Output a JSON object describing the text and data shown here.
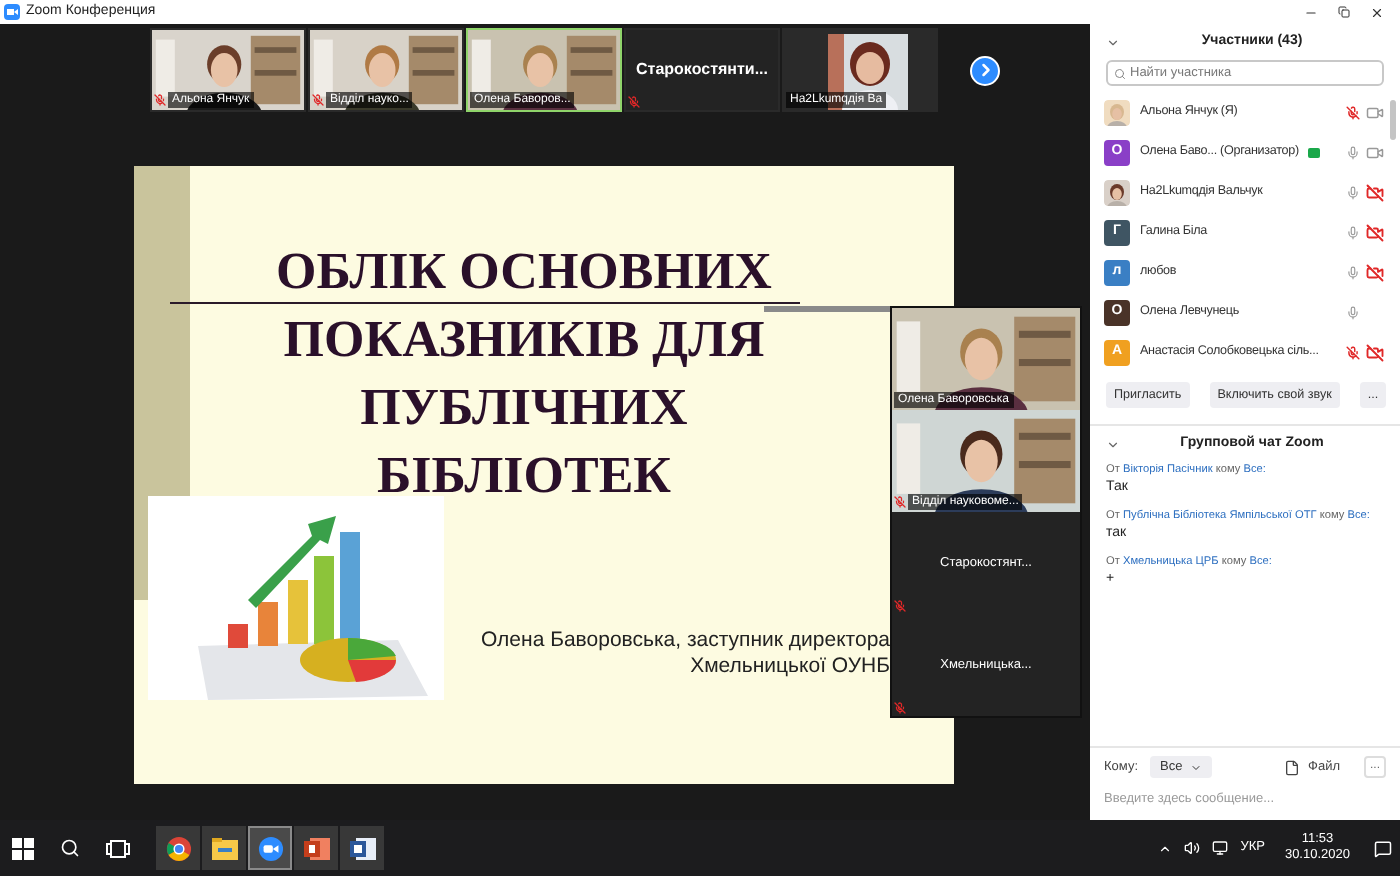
{
  "window": {
    "title": "Zoom Конференция"
  },
  "thumbnails": [
    {
      "kind": "video",
      "name": "Альона Янчук",
      "muted": true,
      "selected": false
    },
    {
      "kind": "video",
      "name": "Відділ науко...",
      "muted": true,
      "selected": false
    },
    {
      "kind": "video",
      "name": "Олена Баворов...",
      "muted": false,
      "selected": true
    },
    {
      "kind": "name",
      "name": "Старокостянти...",
      "muted": true,
      "selected": false
    },
    {
      "name": "Ha2Lkumqдія Ва",
      "muted": false,
      "selected": false
    }
  ],
  "slide": {
    "title": [
      "ОБЛІК ОСНОВНИХ",
      "ПОКАЗНИКІВ ДЛЯ",
      "ПУБЛІЧНИХ",
      "БІБЛІОТЕК"
    ],
    "author": [
      "Олена Баворовська, заступник директора",
      "Хмельницької ОУНБ"
    ]
  },
  "gallery": [
    {
      "kind": "video",
      "name": "Олена Баворовська",
      "muted": false
    },
    {
      "kind": "video",
      "name": "Відділ науковоме...",
      "muted": true
    },
    {
      "kind": "name",
      "name": "Старокостянт...",
      "muted": true
    },
    {
      "kind": "name",
      "name": "Хмельницька...",
      "muted": true
    }
  ],
  "participants_panel": {
    "title": "Участники (43)",
    "search_placeholder": "Найти участника",
    "participants": [
      {
        "name": "Альона Янчук (Я)",
        "host_badge": false,
        "mic_muted": true,
        "video_icon": true,
        "video_off": false
      },
      {
        "name": "Олена Баво... (Организатор)",
        "avatar": {
          "kind": "letter",
          "letter": "О",
          "color": "#8a3fc7"
        },
        "host_badge": true,
        "mic_muted": false,
        "video_icon": true,
        "video_off": false
      },
      {
        "name": "Ha2Lkumqдія Вальчук",
        "host_badge": false,
        "mic_muted": false,
        "video_icon": true,
        "video_off": true
      },
      {
        "name": "Галина Біла",
        "avatar": {
          "kind": "letter",
          "letter": "Г",
          "color": "#3f5563"
        },
        "host_badge": false,
        "mic_muted": false,
        "video_icon": true,
        "video_off": true
      },
      {
        "name": "любов",
        "avatar": {
          "kind": "letter",
          "letter": "л",
          "color": "#3a7fc4"
        },
        "host_badge": false,
        "mic_muted": false,
        "video_icon": true,
        "video_off": true
      },
      {
        "name": "Олена Левчунець",
        "avatar": {
          "kind": "letter",
          "letter": "О",
          "color": "#4a3328"
        },
        "host_badge": false,
        "mic_muted": false,
        "video_icon": false
      },
      {
        "name": "Анастасія Солобковецька сіль...",
        "avatar": {
          "kind": "letter",
          "letter": "А",
          "color": "#f0a020"
        },
        "host_badge": false,
        "mic_muted": true,
        "video_icon": true,
        "video_off": true
      }
    ],
    "buttons": [
      "Пригласить",
      "Включить свой звук",
      "..."
    ]
  },
  "chat": {
    "title": "Групповой чат Zoom",
    "messages": [
      {
        "from_word": "От",
        "sender": "Вікторія Пасічник",
        "to_word": "кому",
        "recipient": "Все:",
        "text": "Так"
      },
      {
        "from_word": "От",
        "sender": "Публічна Бібліотека Ямпільської ОТГ",
        "to_word": "кому",
        "recipient": "Все:",
        "text": "так"
      },
      {
        "from_word": "От",
        "sender": "Хмельницька ЦРБ",
        "to_word": "кому",
        "recipient": "Все:",
        "text": "+"
      }
    ],
    "to_label": "Кому:",
    "to_value": "Все",
    "file_button": "Файл",
    "more_button": "...",
    "placeholder": "Введите здесь сообщение..."
  },
  "taskbar": {
    "language": "УКР",
    "time": "11:53",
    "date": "30.10.2020"
  }
}
